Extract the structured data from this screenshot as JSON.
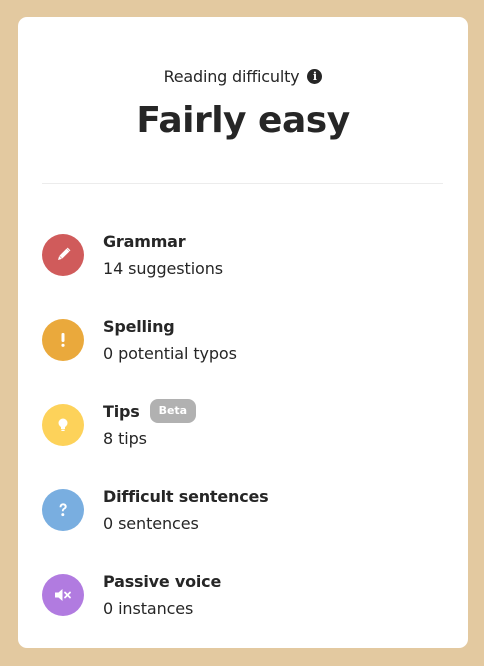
{
  "header": {
    "label": "Reading difficulty",
    "value": "Fairly easy",
    "info_icon": "info-icon"
  },
  "items": [
    {
      "title": "Grammar",
      "subtitle": "14 suggestions",
      "icon": "pencil-icon",
      "color": "#d05b5b"
    },
    {
      "title": "Spelling",
      "subtitle": "0 potential typos",
      "icon": "exclamation-icon",
      "color": "#eaa93c"
    },
    {
      "title": "Tips",
      "badge": "Beta",
      "subtitle": "8 tips",
      "icon": "lightbulb-icon",
      "color": "#fdd25a"
    },
    {
      "title": "Difficult sentences",
      "subtitle": "0 sentences",
      "icon": "question-icon",
      "color": "#79aee0"
    },
    {
      "title": "Passive voice",
      "subtitle": "0 instances",
      "icon": "speaker-mute-icon",
      "color": "#b17be0"
    }
  ],
  "colors": {
    "background": "#e3c9a0",
    "card": "#ffffff",
    "text": "#262626",
    "badge": "#b1b1b1"
  }
}
